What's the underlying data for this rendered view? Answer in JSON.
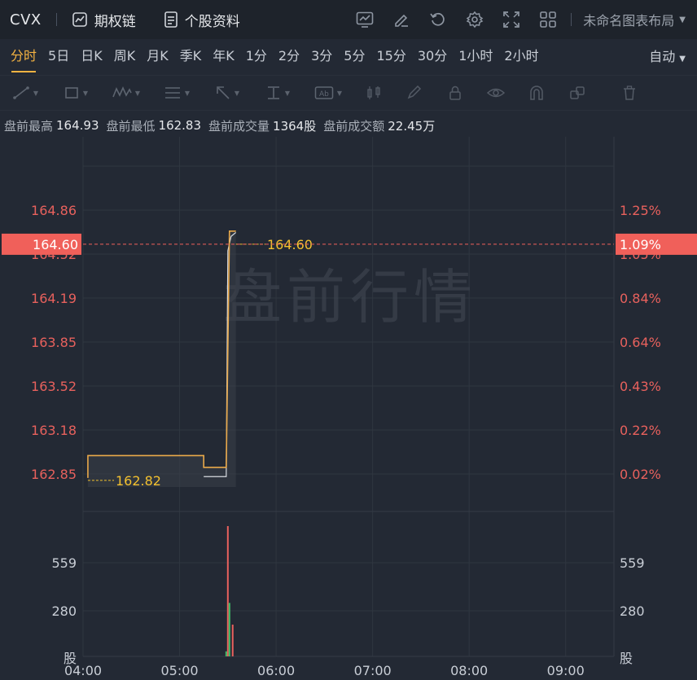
{
  "header": {
    "symbol": "CVX",
    "options_chain": "期权链",
    "stock_profile": "个股资料",
    "layout_name": "未命名图表布局"
  },
  "periods": [
    "分时",
    "5日",
    "日K",
    "周K",
    "月K",
    "季K",
    "年K",
    "1分",
    "2分",
    "3分",
    "5分",
    "15分",
    "30分",
    "1小时",
    "2小时"
  ],
  "active_period": "分时",
  "auto_label": "自动",
  "stats": {
    "high_label": "盘前最高",
    "high_value": "164.93",
    "low_label": "盘前最低",
    "low_value": "162.83",
    "volume_label": "盘前成交量",
    "volume_value": "1364股",
    "amount_label": "盘前成交额",
    "amount_value": "22.45万"
  },
  "colors": {
    "price_line": "#e9a94a",
    "avg_line": "#d7dbe0",
    "axis_red": "#e8615d",
    "up_volume": "#3fbf6a",
    "down_volume": "#e8615d",
    "current_tag": "#f0605a",
    "price_label": "#f3c12f"
  },
  "chart_data": {
    "type": "line",
    "watermark": "盘前行情",
    "x_ticks": [
      "04:00",
      "05:00",
      "06:00",
      "07:00",
      "08:00",
      "09:00"
    ],
    "x_range": [
      "04:00",
      "09:30"
    ],
    "y_ticks": [
      "164.86",
      "164.52",
      "164.19",
      "163.85",
      "163.52",
      "163.18",
      "162.85"
    ],
    "y_range": [
      162.85,
      164.86
    ],
    "pct_ticks": [
      "1.25%",
      "1.05%",
      "0.84%",
      "0.64%",
      "0.43%",
      "0.22%",
      "0.02%"
    ],
    "current_price": "164.60",
    "current_pct": "1.09%",
    "start_price_label": "162.82",
    "end_price_label": "164.60",
    "price_series": [
      {
        "t": "04:03",
        "v": 162.82
      },
      {
        "t": "04:03",
        "v": 162.99
      },
      {
        "t": "05:15",
        "v": 162.99
      },
      {
        "t": "05:15",
        "v": 162.9
      },
      {
        "t": "05:29",
        "v": 162.9
      },
      {
        "t": "05:31",
        "v": 164.7
      },
      {
        "t": "05:35",
        "v": 164.7
      }
    ],
    "avg_series": [
      {
        "t": "05:15",
        "v": 162.83
      },
      {
        "t": "05:29",
        "v": 162.83
      },
      {
        "t": "05:30",
        "v": 164.55
      },
      {
        "t": "05:32",
        "v": 164.66
      },
      {
        "t": "05:35",
        "v": 164.69
      }
    ],
    "volume_ticks": [
      "559",
      "280"
    ],
    "volume_unit": "股",
    "volume_range": [
      0,
      838
    ],
    "volume_bars": [
      {
        "t": "05:29",
        "v": 30,
        "dir": "up"
      },
      {
        "t": "05:30",
        "v": 880,
        "dir": "down"
      },
      {
        "t": "05:31",
        "v": 320,
        "dir": "up"
      },
      {
        "t": "05:33",
        "v": 190,
        "dir": "down"
      }
    ]
  }
}
